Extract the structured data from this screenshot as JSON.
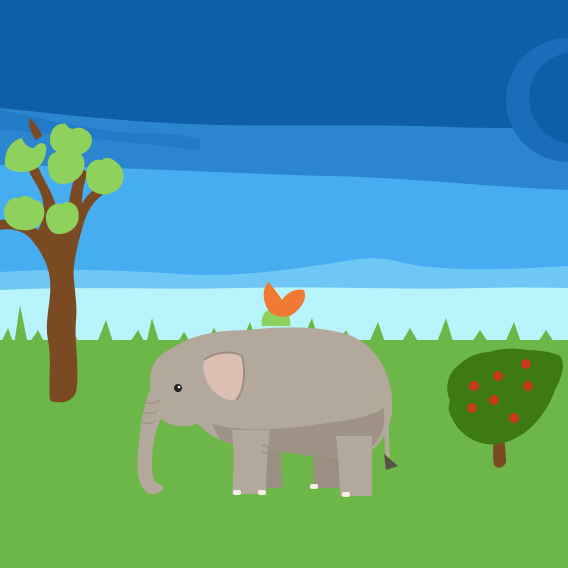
{
  "scene": {
    "elements": [
      "sky",
      "clouds",
      "tree",
      "grass",
      "elephant",
      "flower",
      "berry-bush"
    ],
    "colors": {
      "sky_top": "#0f5ea8",
      "sky_mid": "#2b86cf",
      "sky_light": "#46aef0",
      "horizon": "#b8f4fb",
      "grass": "#6db648",
      "grass_dark": "#5fa83e",
      "elephant": "#b3a89c",
      "elephant_shadow": "#9a8f82",
      "elephant_ear": "#dcbfb0",
      "tree_trunk": "#7a4a22",
      "tree_leaves": "#8fd15d",
      "bush": "#3d7a12",
      "berries": "#c73a1e",
      "flower_petals": "#f07a34",
      "flower_leaves": "#8fd15d"
    }
  }
}
